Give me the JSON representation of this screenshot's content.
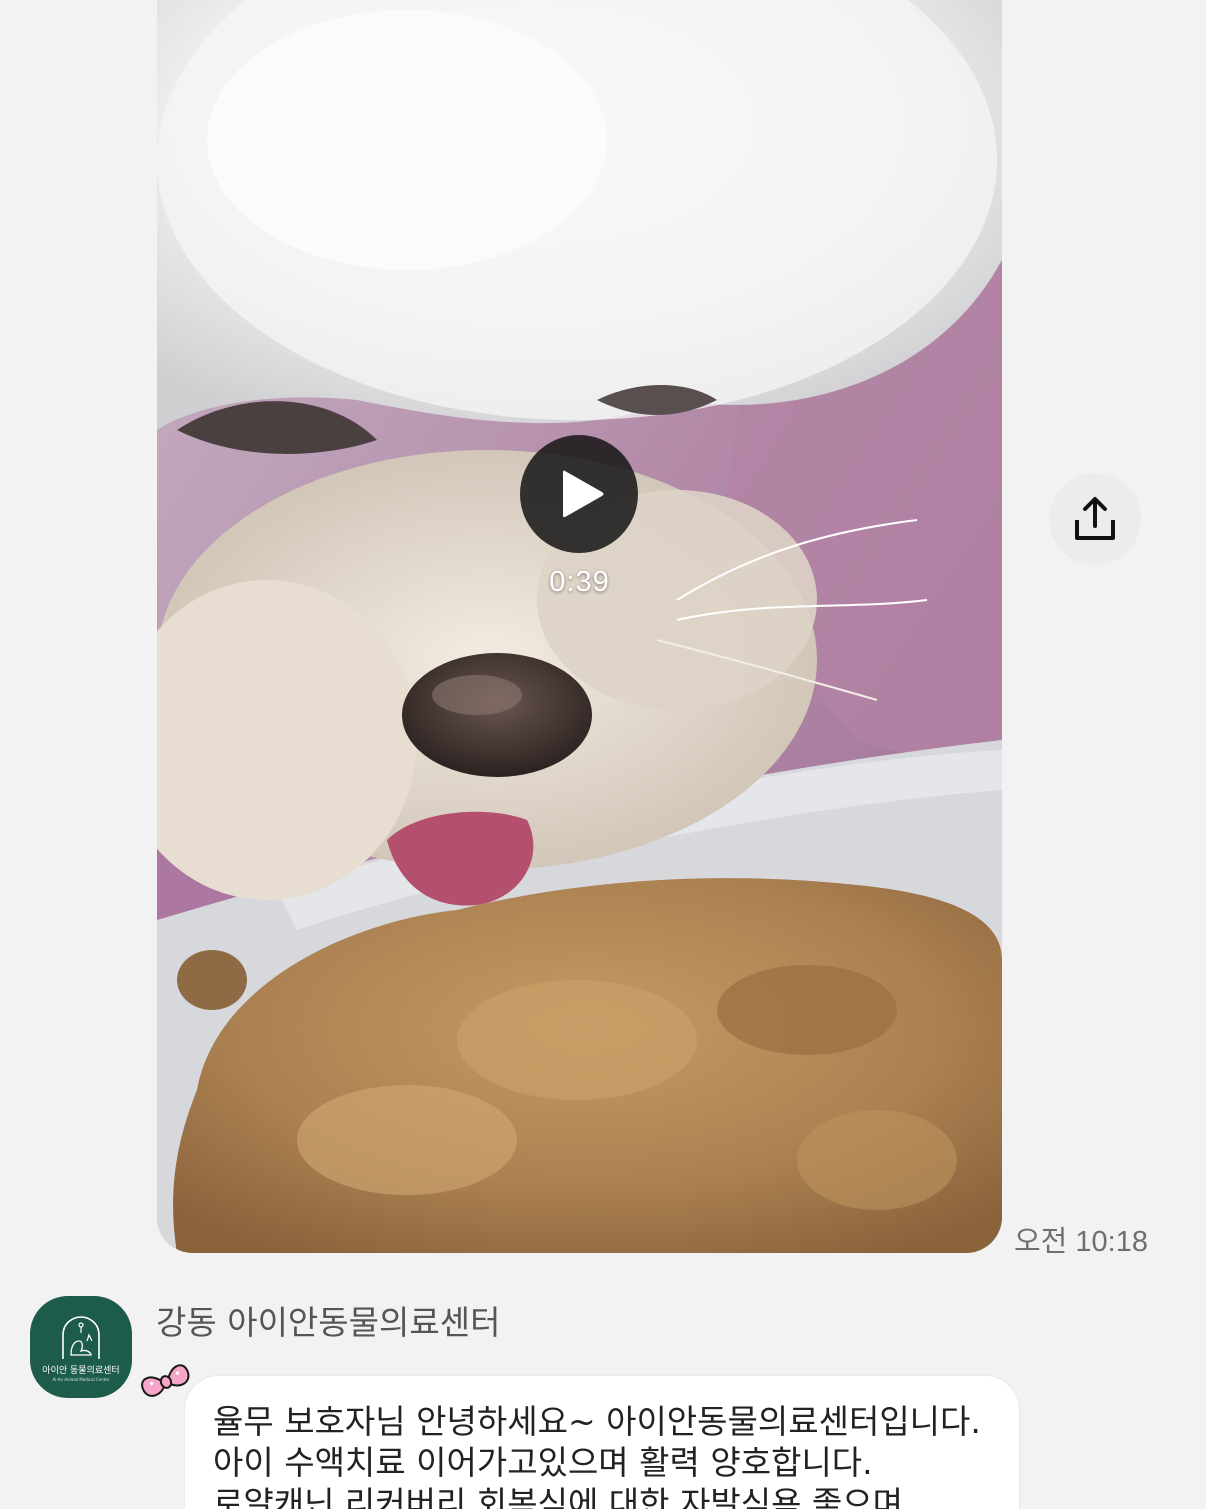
{
  "video_message": {
    "duration": "0:39",
    "thumbnail_subject": "dog-eating-food-thumbnail",
    "play_icon": "play-icon",
    "share_icon": "share-icon",
    "time": "오전 10:18"
  },
  "sender": {
    "name": "강동 아이안동물의료센터",
    "avatar": {
      "name": "아이안 동물의료센터",
      "subtitle": "Ai-An Animal Medical Center",
      "color": "#1d5b4b"
    },
    "decoration_icon": "ribbon-icon"
  },
  "text_message": {
    "text": "율무 보호자님 안녕하세요~ 아이안동물의료센터입니다. 아이 수액치료 이어가고있으며 활력 양호합니다. 로얄캐닌 리커버리 회복식에 대한 자발식욕 좋으며 급하게 먹"
  },
  "colors": {
    "background": "#f2f2f2",
    "bubble": "#ffffff",
    "avatar_green": "#1d5b4b",
    "ribbon_pink": "#f6a6c8"
  }
}
